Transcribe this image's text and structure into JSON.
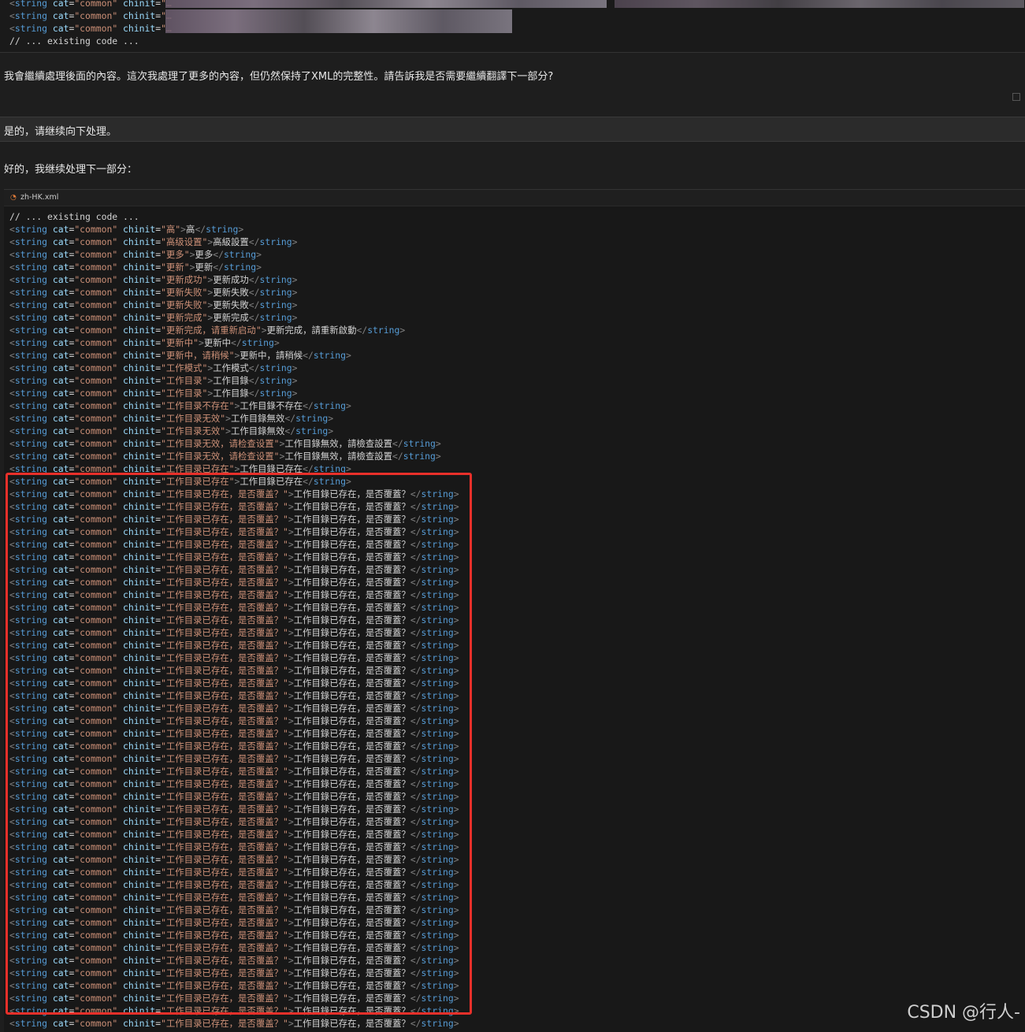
{
  "top_block": {
    "line1": {
      "tag": "string",
      "attr1": "cat",
      "val1": "common",
      "attr2": "chinit",
      "val2": "…"
    },
    "line2": {
      "tag": "string",
      "attr1": "cat",
      "val1": "common",
      "attr2": "chinit",
      "val2": "…"
    },
    "line3": {
      "tag": "string",
      "attr1": "cat",
      "val1": "common",
      "attr2": "chinit",
      "val2": "…"
    },
    "comment": "// ... existing code ..."
  },
  "messages": {
    "assistant_1": "我會繼續處理後面的內容。這次我處理了更多的內容，但仍然保持了XML的完整性。請告訴我是否需要繼續翻譯下一部分?",
    "user": "是的，请继续向下处理。",
    "assistant_2": "好的，我继续处理下一部分："
  },
  "file": {
    "name": "zh-HK.xml",
    "comment": "// ... existing code ...",
    "tag": "string",
    "cat_attr": "cat",
    "cat_value": "common",
    "chinit_attr": "chinit",
    "lines": [
      {
        "key": "高",
        "value": "高"
      },
      {
        "key": "高级设置",
        "value": "高級設置"
      },
      {
        "key": "更多",
        "value": "更多"
      },
      {
        "key": "更新",
        "value": "更新"
      },
      {
        "key": "更新成功",
        "value": "更新成功"
      },
      {
        "key": "更新失败",
        "value": "更新失敗"
      },
      {
        "key": "更新失败",
        "value": "更新失敗"
      },
      {
        "key": "更新完成",
        "value": "更新完成"
      },
      {
        "key": "更新完成，请重新启动",
        "value": "更新完成，請重新啟動"
      },
      {
        "key": "更新中",
        "value": "更新中"
      },
      {
        "key": "更新中，请稍候",
        "value": "更新中，請稍候"
      },
      {
        "key": "工作模式",
        "value": "工作模式"
      },
      {
        "key": "工作目录",
        "value": "工作目錄"
      },
      {
        "key": "工作目录",
        "value": "工作目錄"
      },
      {
        "key": "工作目录不存在",
        "value": "工作目錄不存在"
      },
      {
        "key": "工作目录无效",
        "value": "工作目錄無效"
      },
      {
        "key": "工作目录无效",
        "value": "工作目錄無效"
      },
      {
        "key": "工作目录无效，请检查设置",
        "value": "工作目錄無效，請檢查設置"
      },
      {
        "key": "工作目录无效，请检查设置",
        "value": "工作目錄無效，請檢查設置"
      },
      {
        "key": "工作目录已存在",
        "value": "工作目錄已存在"
      },
      {
        "key": "工作目录已存在",
        "value": "工作目錄已存在"
      }
    ],
    "repeated_line": {
      "key": "工作目录已存在，是否覆盖？",
      "value": "工作目錄已存在，是否覆蓋？"
    },
    "repeated_count": 43
  },
  "watermark": "CSDN @行人-",
  "colors": {
    "highlight": "#e8302a",
    "keyword": "#569cd6",
    "attr": "#9cdcfe",
    "value": "#ce9178"
  }
}
